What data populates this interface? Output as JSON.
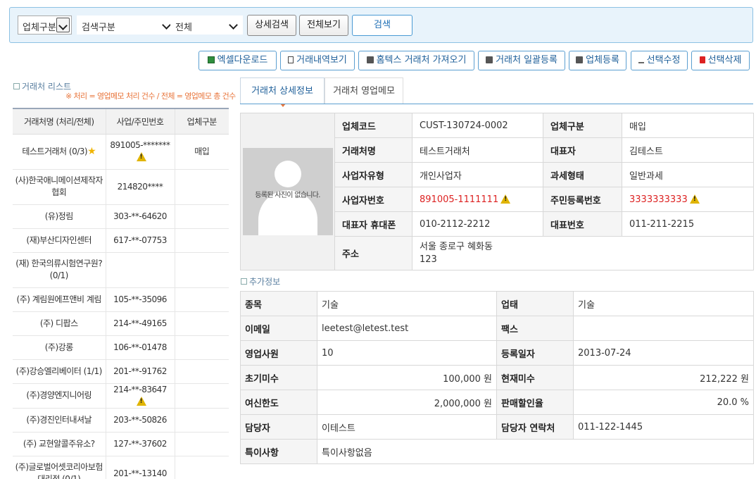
{
  "search": {
    "business_type": "업체구분",
    "search_type": "검색구분",
    "scope": "전체",
    "detail_search_label": "상세검색",
    "view_all_label": "전체보기",
    "search_label": "검색"
  },
  "toolbar": {
    "excel_label": "엑셀다운로드",
    "history_label": "거래내역보기",
    "hometax_label": "홈텍스 거래처 가져오기",
    "bulk_label": "거래처 일괄등록",
    "register_label": "업체등록",
    "edit_label": "선택수정",
    "delete_label": "선택삭제"
  },
  "list": {
    "title": "거래처 리스트",
    "note": "※ 처리 = 영업메모 처리 건수 / 전체 = 영업메모 총 건수",
    "headers": [
      "거래처명 (처리/전체)",
      "사업/주민번호",
      "업체구분"
    ],
    "rows": [
      {
        "name": "테스트거래처 (0/3)",
        "number": "891005-*******",
        "type": "매입"
      },
      {
        "name": "(사)한국애니메이션제작자협회",
        "number": "214820****",
        "type": ""
      },
      {
        "name": "(유)정림",
        "number": "303-**-64620",
        "type": ""
      },
      {
        "name": "(재)부산디자인센터",
        "number": "617-**-07753",
        "type": ""
      },
      {
        "name": "(재) 한국의류시험연구원? (0/1)",
        "number": "",
        "type": ""
      },
      {
        "name": "(주) 계림원에프앤비 계림",
        "number": "105-**-35096",
        "type": ""
      },
      {
        "name": "(주) 디팝스",
        "number": "214-**-49165",
        "type": ""
      },
      {
        "name": "(주)강롱",
        "number": "106-**-01478",
        "type": ""
      },
      {
        "name": "(주)강승엘리베이터 (1/1)",
        "number": "201-**-91762",
        "type": ""
      },
      {
        "name": "(주)경양엔지니어링",
        "number": "214-**-83647",
        "type": ""
      },
      {
        "name": "(주)경진인터내셔날",
        "number": "203-**-50826",
        "type": ""
      },
      {
        "name": "(주) 교현알콜주유소?",
        "number": "127-**-37602",
        "type": ""
      },
      {
        "name": "(주)글로벌어셋코리아보험대리점 (0/1)",
        "number": "201-**-13140",
        "type": ""
      }
    ]
  },
  "tabs": {
    "detail": "거래처 상세정보",
    "memo": "거래처 영업메모"
  },
  "detail": {
    "photo_text": "등록된 사진이 없습니다.",
    "code_label": "업체코드",
    "code": "CUST-130724-0002",
    "type_label": "업체구분",
    "type": "매입",
    "name_label": "거래처명",
    "name": "테스트거래처",
    "ceo_label": "대표자",
    "ceo": "김테스트",
    "biz_type_label": "사업자유형",
    "biz_type": "개인사업자",
    "tax_label": "과세형태",
    "tax": "일반과세",
    "biz_no_label": "사업자번호",
    "biz_no": "891005-1111111",
    "resident_label": "주민등록번호",
    "resident": "3333333333",
    "mobile_label": "대표자 휴대폰",
    "mobile": "010-2112-2212",
    "phone_label": "대표번호",
    "phone": "011-211-2215",
    "address_label": "주소",
    "address1": "서울 종로구 혜화동",
    "address2": "123"
  },
  "extra": {
    "title": "추가정보",
    "item_label": "종목",
    "item": "기술",
    "biz_label": "업태",
    "biz": "기술",
    "email_label": "이메일",
    "email": "leetest@letest.test",
    "fax_label": "팩스",
    "fax": "",
    "sales_label": "영업사원",
    "sales": "10",
    "regdate_label": "등록일자",
    "regdate": "2013-07-24",
    "initial_label": "초기미수",
    "initial": "100,000 원",
    "current_label": "현재미수",
    "current": "212,222 원",
    "credit_label": "여신한도",
    "credit": "2,000,000 원",
    "discount_label": "판매할인율",
    "discount": "20.0 %",
    "manager_label": "담당자",
    "manager": "이테스트",
    "manager_phone_label": "담당자 연락처",
    "manager_phone": "011-122-1445",
    "note_label": "특이사항",
    "note": "특이사항없음"
  }
}
